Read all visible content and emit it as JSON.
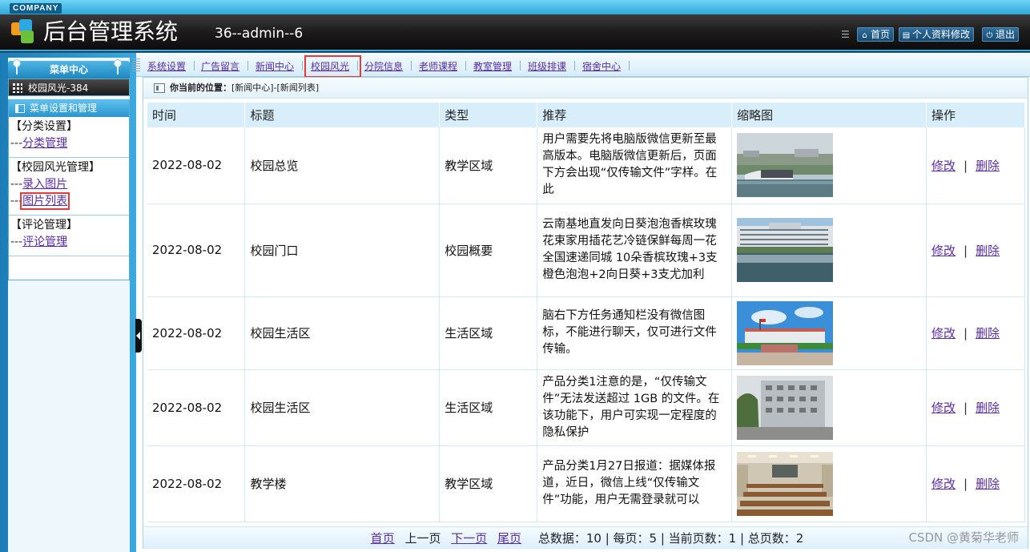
{
  "header": {
    "company_badge": "COMPANY",
    "title": "后台管理系统",
    "user": "36--admin--6",
    "buttons": [
      {
        "label": "首页",
        "icon": "home-icon"
      },
      {
        "label": "个人资料修改",
        "icon": "profile-icon"
      },
      {
        "label": "退出",
        "icon": "power-icon"
      }
    ],
    "colors": {
      "bar": "#1a1a1a",
      "accent": "#2ea5d9"
    }
  },
  "sidebar": {
    "menu_center": "菜单中心",
    "current_category": "校园风光-384",
    "panel_title": "菜单设置和管理",
    "groups": [
      {
        "title": "【分类设置】",
        "items": [
          {
            "prefix": "---",
            "label": "分类管理"
          }
        ]
      },
      {
        "title": "【校园风光管理】",
        "items": [
          {
            "prefix": "---",
            "label": "录入图片"
          },
          {
            "prefix": "---",
            "label": "图片列表",
            "highlighted": true
          }
        ]
      },
      {
        "title": "【评论管理】",
        "items": [
          {
            "prefix": "---",
            "label": "评论管理"
          }
        ]
      }
    ]
  },
  "nav": {
    "tabs": [
      {
        "label": "系统设置"
      },
      {
        "label": "广告留言"
      },
      {
        "label": "新闻中心"
      },
      {
        "label": "校园风光",
        "active": true
      },
      {
        "label": "分院信息"
      },
      {
        "label": "老师课程"
      },
      {
        "label": "教室管理"
      },
      {
        "label": "班级排课"
      },
      {
        "label": "宿舍中心"
      }
    ]
  },
  "breadcrumb": {
    "label": "你当前的位置：",
    "path": "[新闻中心]-[新闻列表]"
  },
  "table": {
    "headers": [
      "时间",
      "标题",
      "类型",
      "推荐",
      "缩略图",
      "操作"
    ],
    "edit_label": "修改",
    "delete_label": "删除",
    "op_separator": "|",
    "rows": [
      {
        "time": "2022-08-02",
        "title": "校园总览",
        "type": "教学区域",
        "rec": "用户需要先将电脑版微信更新至最高版本。电脑版微信更新后，页面下方会出现“仅传输文件”字样。在此",
        "thumb": "campus-aerial-photo"
      },
      {
        "time": "2022-08-02",
        "title": "校园门口",
        "type": "校园概要",
        "rec": "云南基地直发向日葵泡泡香槟玫瑰花束家用插花艺冷链保鲜每周一花全国速递同城 10朵香槟玫瑰+3支橙色泡泡+2向日葵+3支尤加利",
        "thumb": "campus-gate-photo"
      },
      {
        "time": "2022-08-02",
        "title": "校园生活区",
        "type": "生活区域",
        "rec": "脑右下方任务通知栏没有微信图标，不能进行聊天，仅可进行文件传输。",
        "thumb": "campus-square-photo"
      },
      {
        "time": "2022-08-02",
        "title": "校园生活区",
        "type": "生活区域",
        "rec": "产品分类1注意的是，“仅传输文件”无法发送超过 1GB 的文件。在该功能下，用户可实现一定程度的隐私保护",
        "thumb": "dormitory-building-photo"
      },
      {
        "time": "2022-08-02",
        "title": "教学楼",
        "type": "教学区域",
        "rec": "产品分类1月27日报道：据媒体报道，近日，微信上线“仅传输文件”功能，用户无需登录就可以",
        "thumb": "lecture-hall-photo"
      }
    ]
  },
  "pager": {
    "first": "首页",
    "prev": "上一页",
    "next": "下一页",
    "last": "尾页",
    "stats": "总数据：10 | 每页：5 | 当前页数：1 | 总页数：2"
  },
  "watermark": "CSDN @黄菊华老师"
}
